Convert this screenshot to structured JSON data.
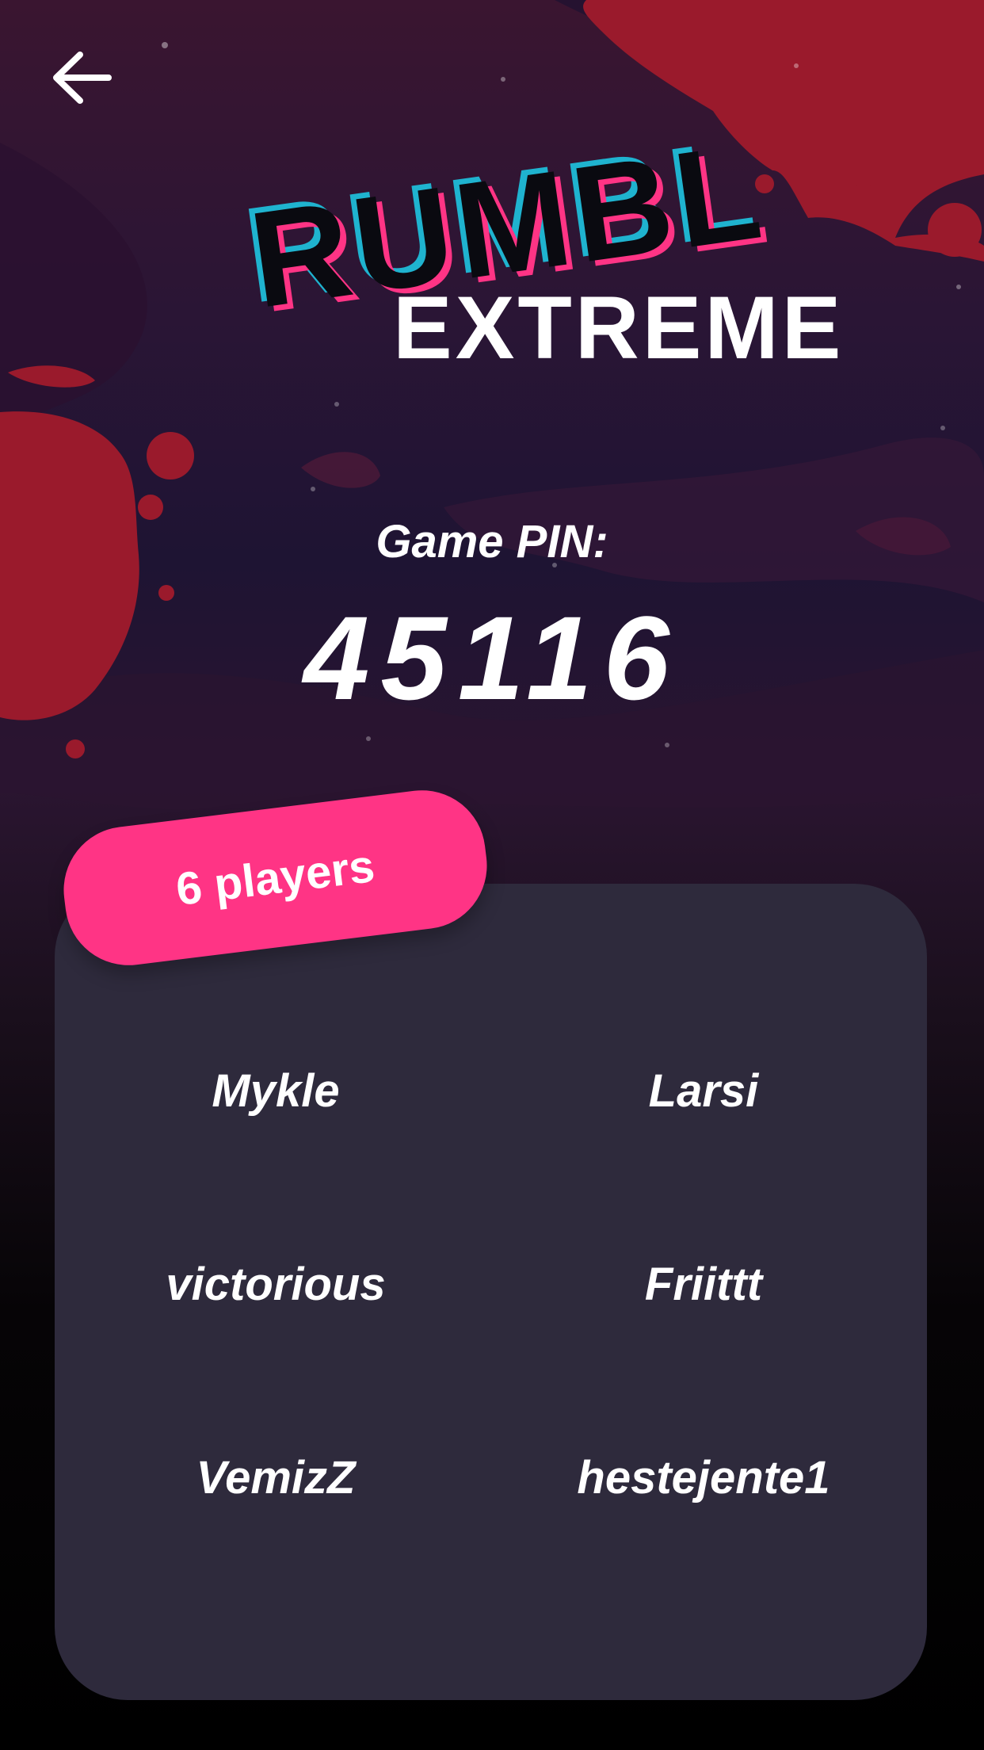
{
  "nav": {
    "back_icon": "arrow-left-icon"
  },
  "logo": {
    "word_top": "RUMBL",
    "word_bottom": "EXTREME"
  },
  "game": {
    "pin_label": "Game PIN:",
    "pin_value": "45116"
  },
  "players": {
    "count_label": "6 players",
    "names": [
      "Mykle",
      "Larsi",
      "victorious",
      "Friittt",
      "VemizZ",
      "hestejente1"
    ]
  },
  "colors": {
    "accent_pink": "#ff3485",
    "accent_cyan": "#1fb3cf",
    "splash_red": "#9a1a2c",
    "panel_bg": "#2e2a3c"
  }
}
